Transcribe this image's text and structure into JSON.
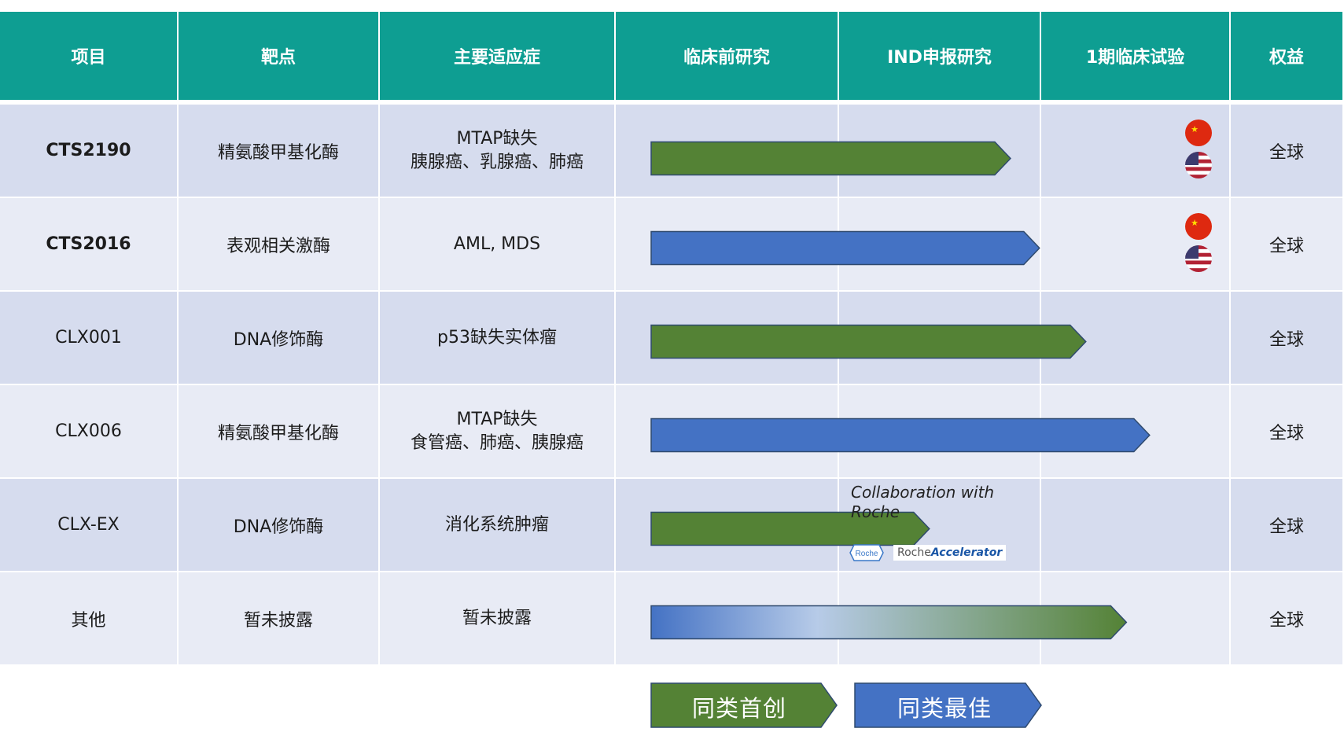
{
  "colors": {
    "header_bg": "#0e9e92",
    "row_odd": "#d6dcee",
    "row_even": "#e8ebf5",
    "first_in_class": "#548235",
    "best_in_class": "#4472c4",
    "bar_border": "#2f4a6e"
  },
  "headers": [
    "项目",
    "靶点",
    "主要适应症",
    "临床前研究",
    "IND申报研究",
    "1期临床试验",
    "权益"
  ],
  "stage_order": [
    "临床前研究",
    "IND申报研究",
    "1期临床试验"
  ],
  "rows": [
    {
      "project": "CTS2190",
      "bold": true,
      "target": "精氨酸甲基化酶",
      "indication": [
        "MTAP缺失",
        "胰腺癌、乳腺癌、肺癌"
      ],
      "rights": "全球",
      "bar_type": "first_in_class",
      "progress": 0.62,
      "flags": [
        "china-flag-icon",
        "usa-flag-icon"
      ]
    },
    {
      "project": "CTS2016",
      "bold": true,
      "target": "表观相关激酶",
      "indication": [
        "AML, MDS"
      ],
      "rights": "全球",
      "bar_type": "best_in_class",
      "progress": 0.67,
      "flags": [
        "china-flag-icon",
        "usa-flag-icon"
      ]
    },
    {
      "project": "CLX001",
      "bold": false,
      "target": "DNA修饰酶",
      "indication": [
        "p53缺失实体瘤"
      ],
      "rights": "全球",
      "bar_type": "first_in_class",
      "progress": 0.75,
      "flags": []
    },
    {
      "project": "CLX006",
      "bold": false,
      "target": "精氨酸甲基化酶",
      "indication": [
        "MTAP缺失",
        "食管癌、肺癌、胰腺癌"
      ],
      "rights": "全球",
      "bar_type": "best_in_class",
      "progress": 0.86,
      "flags": []
    },
    {
      "project": "CLX-EX",
      "bold": false,
      "target": "DNA修饰酶",
      "indication": [
        "消化系统肿瘤"
      ],
      "rights": "全球",
      "bar_type": "first_in_class",
      "progress": 0.48,
      "flags": [],
      "note": {
        "line1": "Collaboration with",
        "line2": "Roche",
        "logo_text": "Roche",
        "accel_prefix": "Roche",
        "accel_suffix": "Accelerator"
      }
    },
    {
      "project": "其他",
      "bold": false,
      "target": "暂未披露",
      "indication": [
        "暂未披露"
      ],
      "rights": "全球",
      "bar_type": "gradient",
      "progress": 0.82,
      "flags": []
    }
  ],
  "legend": [
    {
      "label": "同类首创",
      "type": "first_in_class"
    },
    {
      "label": "同类最佳",
      "type": "best_in_class"
    }
  ]
}
